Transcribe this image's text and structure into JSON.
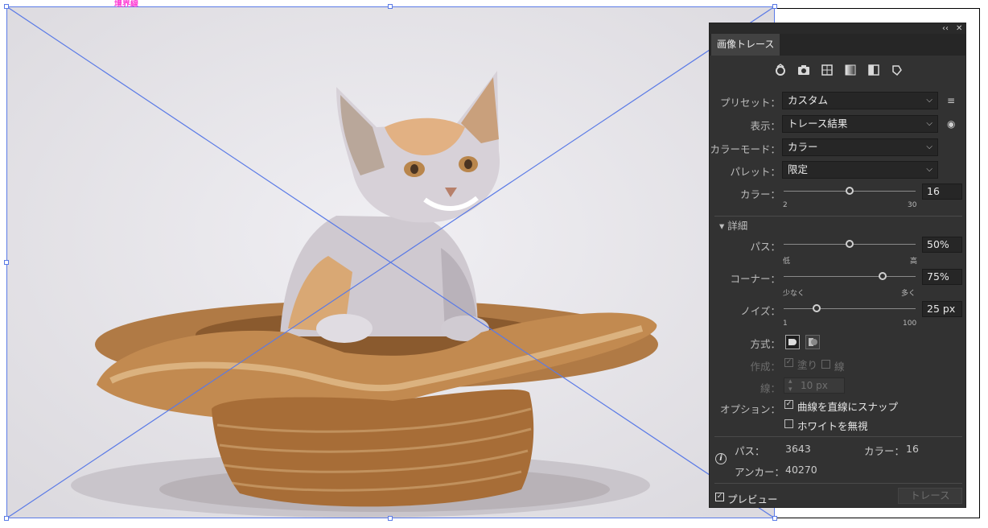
{
  "canvas": {
    "boundary_label": "境界線"
  },
  "panel": {
    "tab_label": "画像トレース",
    "topbar_collapse": "‹‹",
    "topbar_close": "✕",
    "preset_icons": [
      "auto-color-icon",
      "camera-icon",
      "grid-icon",
      "gradient-icon",
      "half-contrast-icon",
      "outline-icon"
    ],
    "preset": {
      "label": "プリセット：",
      "value": "カスタム"
    },
    "view": {
      "label": "表示：",
      "value": "トレース結果"
    },
    "color_mode": {
      "label": "カラーモード：",
      "value": "カラー"
    },
    "palette": {
      "label": "パレット：",
      "value": "限定"
    },
    "colors": {
      "label": "カラー：",
      "value": "16",
      "min": "2",
      "max": "30",
      "level": 0.5
    },
    "advanced": {
      "label": "詳細"
    },
    "paths": {
      "label": "パス：",
      "value": "50%",
      "min": "低",
      "max": "高",
      "level": 0.5
    },
    "corners": {
      "label": "コーナー：",
      "value": "75%",
      "min": "少なく",
      "max": "多く",
      "level": 0.75
    },
    "noise": {
      "label": "ノイズ：",
      "value": "25 px",
      "min": "1",
      "max": "100",
      "level": 0.25
    },
    "method": {
      "label": "方式："
    },
    "create": {
      "label": "作成：",
      "fill_label": "塗り",
      "stroke_label": "線"
    },
    "stroke": {
      "label": "線：",
      "value": "10 px"
    },
    "options": {
      "label": "オプション：",
      "snap_label": "曲線を直線にスナップ",
      "ignore_white_label": "ホワイトを無視"
    },
    "stats": {
      "paths_label": "パス：",
      "paths_value": "3643",
      "colors_label": "カラー：",
      "colors_value": "16",
      "anchors_label": "アンカー：",
      "anchors_value": "40270"
    },
    "preview_label": "プレビュー",
    "trace_button": "トレース"
  }
}
